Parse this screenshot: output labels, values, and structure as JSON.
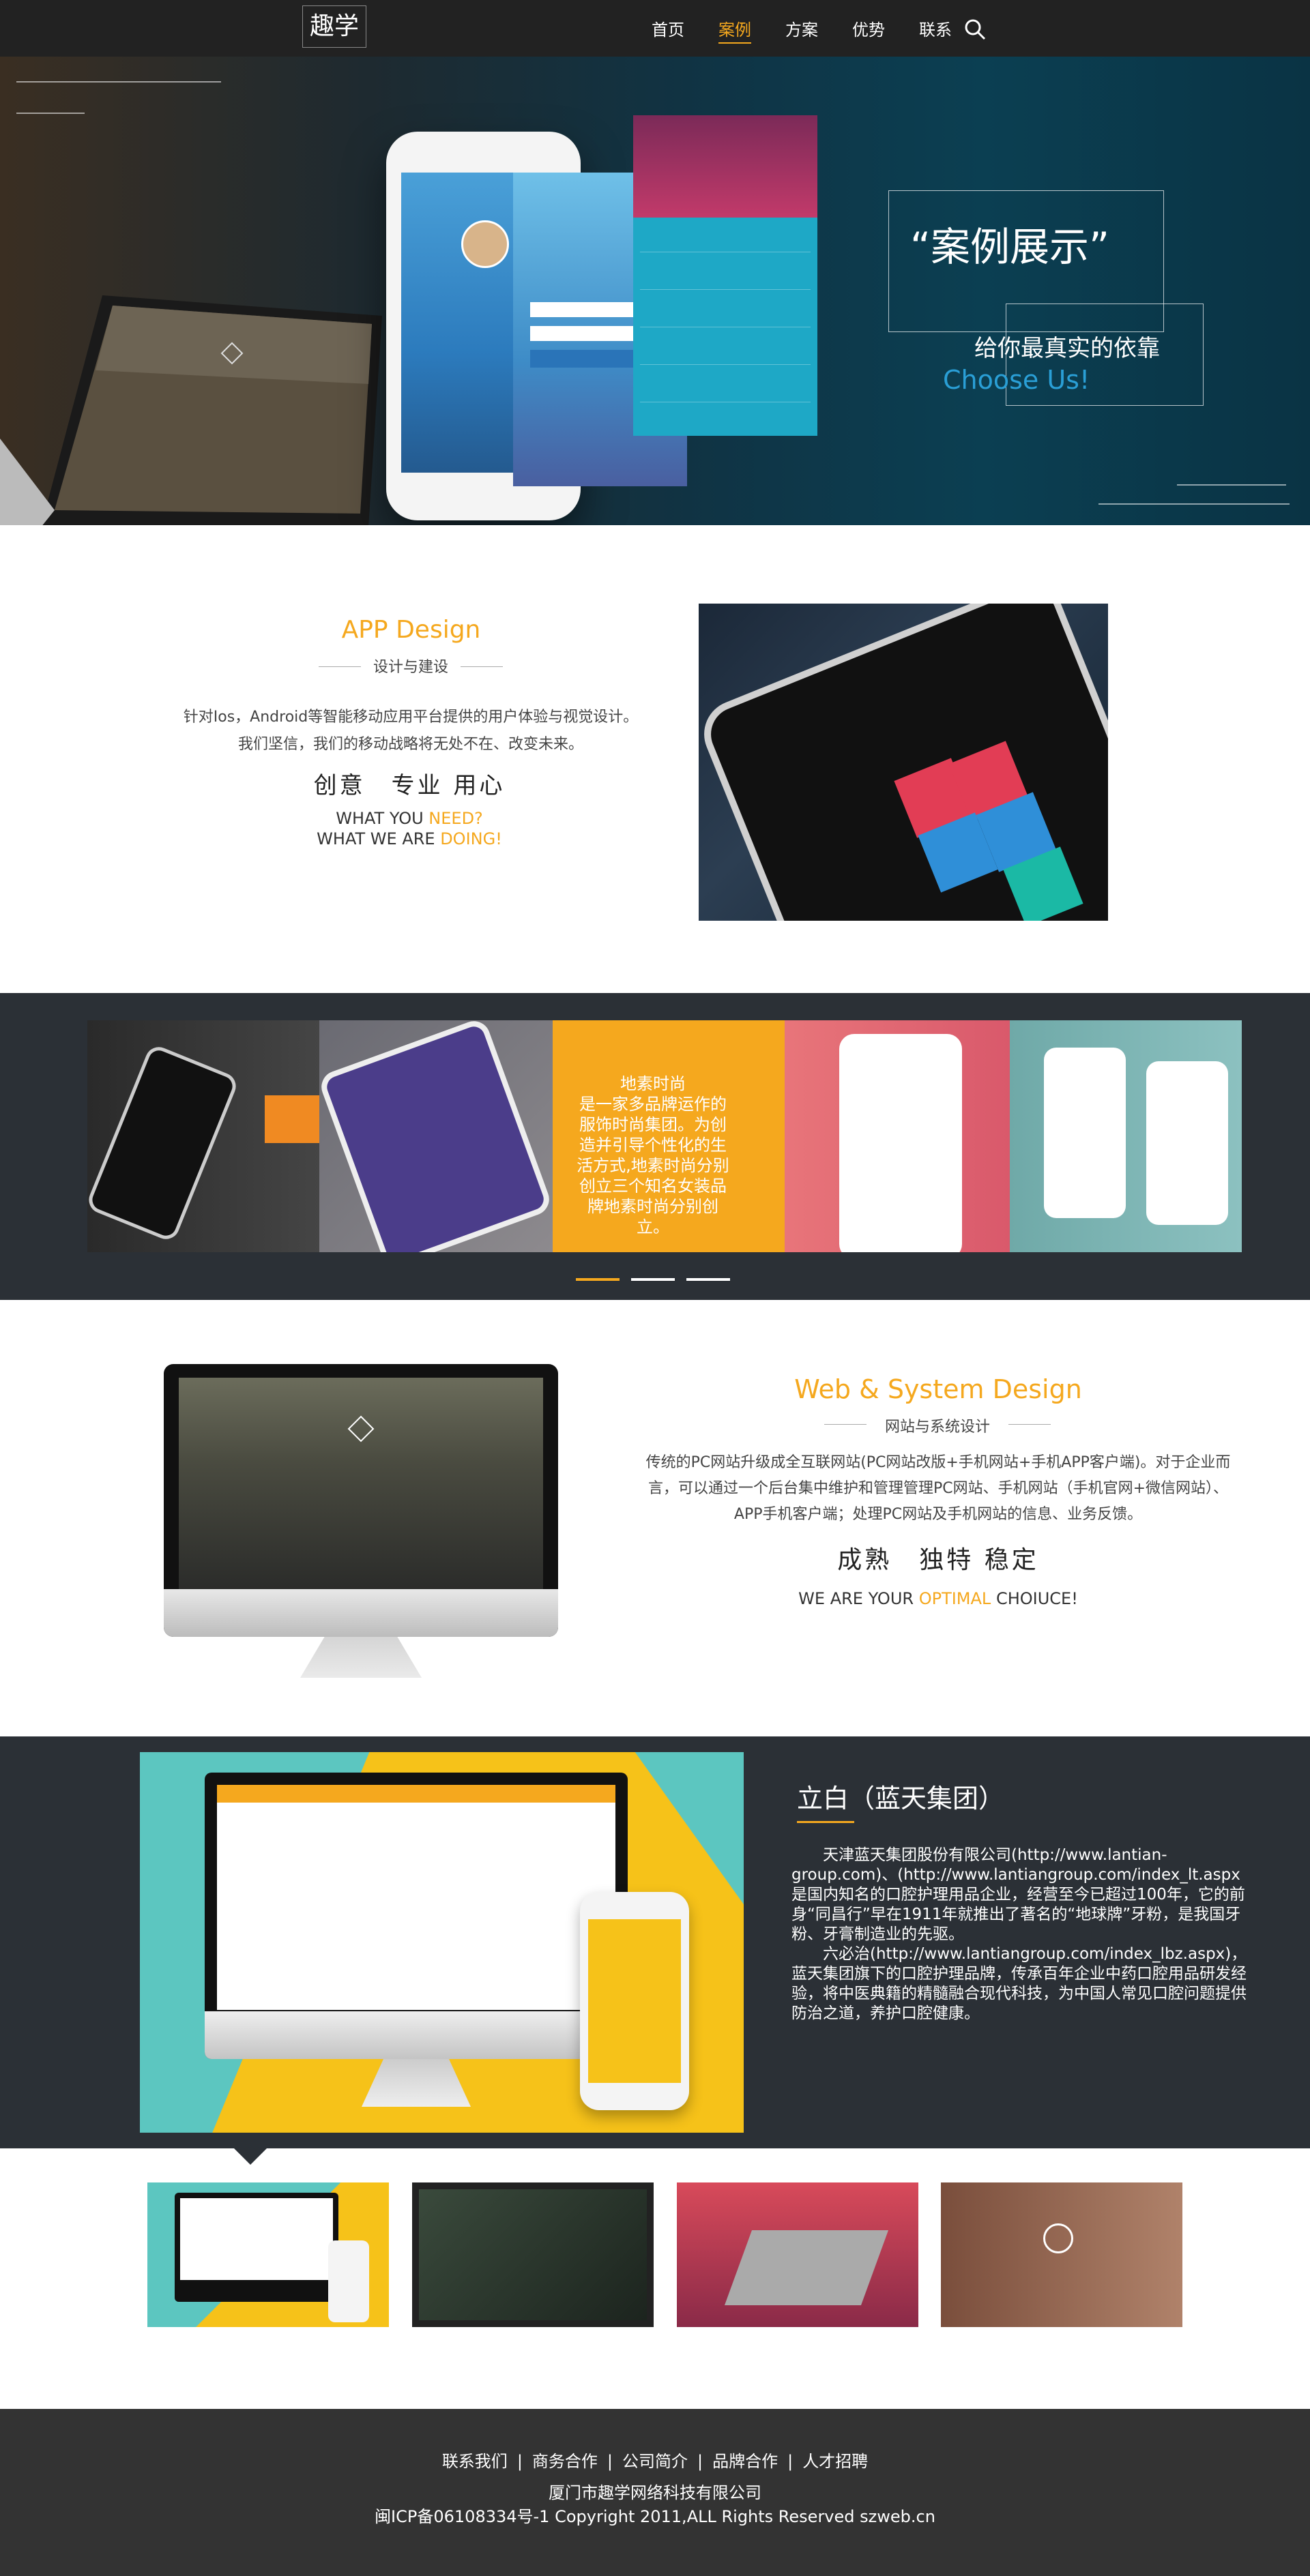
{
  "nav": {
    "logo": "趣学",
    "links": [
      "首页",
      "案例",
      "方案",
      "优势",
      "联系"
    ],
    "active_index": 1,
    "search_icon": "search-icon"
  },
  "hero": {
    "title": "“案例展示”",
    "subtitle": "给你最真实的依靠",
    "choose": "Choose Us!"
  },
  "app_design": {
    "title": "APP Design",
    "subtitle": "设计与建设",
    "desc_line1": "针对Ios，Android等智能移动应用平台提供的用户体验与视觉设计。",
    "desc_line2": "我们坚信，我们的移动战略将无处不在、改变未来。",
    "slogan": "创意　专业  用心",
    "what1_a": "WHAT YOU ",
    "what1_b": "NEED?",
    "what2_a": "WHAT WE ARE ",
    "what2_b": "DOING!"
  },
  "carousel": {
    "item_text": "地素时尚\n是一家多品牌运作的服饰时尚集团。为创造并引导个性化的生活方式,地素时尚分别创立三个知名女装品牌地素时尚分别创立。",
    "active_dot": 0,
    "dot_count": 3
  },
  "web_design": {
    "title": "Web & System Design",
    "subtitle": "网站与系统设计",
    "desc": "传统的PC网站升级成全互联网站(PC网站改版+手机网站+手机APP客户端)。对于企业而言，可以通过一个后台集中维护和管理管理PC网站、手机网站（手机官网+微信网站）、APP手机客户端；处理PC网站及手机网站的信息、业务反馈。",
    "slogan": "成熟　独特  稳定",
    "what_a": "WE ARE YOUR ",
    "what_b": "OPTIMAL",
    "what_c": " CHOIUCE!"
  },
  "case": {
    "title": "立白（蓝天集团）",
    "para1": "天津蓝天集团股份有限公司(http://www.lantian-group.com)、(http://www.lantiangroup.com/index_lt.aspx是国内知名的口腔护理用品企业，经营至今已超过100年，它的前身“同昌行”早在1911年就推出了著名的“地球牌”牙粉，是我国牙粉、牙膏制造业的先驱。",
    "para2": "六必治(http://www.lantiangroup.com/index_lbz.aspx)，蓝天集团旗下的口腔护理品牌，传承百年企业中药口腔用品研发经验，将中医典籍的精髓融合现代科技，为中国人常见口腔问题提供防治之道，养护口腔健康。"
  },
  "footer": {
    "links": [
      "联系我们",
      "商务合作",
      "公司简介",
      "品牌合作",
      "人才招聘"
    ],
    "company": "厦门市趣学网络科技有限公司",
    "icp": "闽ICP备06108334号-1 Copyright 2011,ALL Rights Reserved szweb.cn"
  }
}
